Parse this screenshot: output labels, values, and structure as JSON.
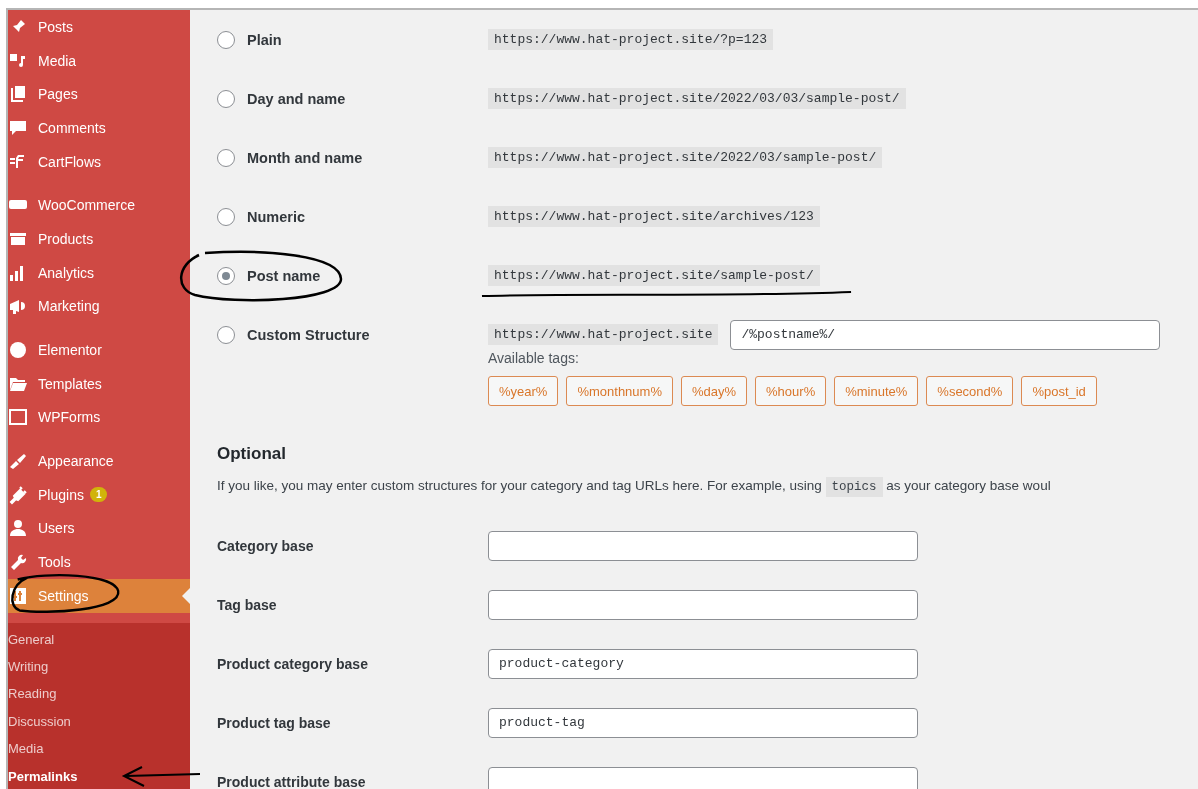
{
  "sidebar": {
    "groups": [
      {
        "items": [
          {
            "label": "Posts"
          },
          {
            "label": "Media"
          },
          {
            "label": "Pages"
          },
          {
            "label": "Comments"
          },
          {
            "label": "CartFlows"
          }
        ]
      },
      {
        "items": [
          {
            "label": "WooCommerce"
          },
          {
            "label": "Products"
          },
          {
            "label": "Analytics"
          },
          {
            "label": "Marketing"
          }
        ]
      },
      {
        "items": [
          {
            "label": "Elementor"
          },
          {
            "label": "Templates"
          },
          {
            "label": "WPForms"
          }
        ]
      },
      {
        "items": [
          {
            "label": "Appearance"
          },
          {
            "label": "Plugins",
            "badge": "1"
          },
          {
            "label": "Users"
          },
          {
            "label": "Tools"
          },
          {
            "label": "Settings",
            "selected": true,
            "circled": true
          }
        ]
      }
    ],
    "submenu": [
      {
        "label": "General",
        "selected": false,
        "arrow": false
      },
      {
        "label": "Writing",
        "selected": false,
        "arrow": false
      },
      {
        "label": "Reading",
        "selected": false,
        "arrow": false
      },
      {
        "label": "Discussion",
        "selected": false,
        "arrow": false
      },
      {
        "label": "Media",
        "selected": false,
        "arrow": false
      },
      {
        "label": "Permalinks",
        "selected": true,
        "arrow": true
      }
    ]
  },
  "permalink_options": [
    {
      "label": "Plain",
      "example": "https://www.hat-project.site/?p=123",
      "selected": false,
      "circled": false,
      "underlined": false
    },
    {
      "label": "Day and name",
      "example": "https://www.hat-project.site/2022/03/03/sample-post/",
      "selected": false,
      "circled": false,
      "underlined": false
    },
    {
      "label": "Month and name",
      "example": "https://www.hat-project.site/2022/03/sample-post/",
      "selected": false,
      "circled": false,
      "underlined": false
    },
    {
      "label": "Numeric",
      "example": "https://www.hat-project.site/archives/123",
      "selected": false,
      "circled": false,
      "underlined": false
    },
    {
      "label": "Post name",
      "example": "https://www.hat-project.site/sample-post/",
      "selected": true,
      "circled": true,
      "underlined": true
    }
  ],
  "custom_structure": {
    "label": "Custom Structure",
    "selected": false,
    "prefix": "https://www.hat-project.site",
    "value": "/%postname%/",
    "tags_label": "Available tags:",
    "tags": [
      "%year%",
      "%monthnum%",
      "%day%",
      "%hour%",
      "%minute%",
      "%second%",
      "%post_id"
    ]
  },
  "optional": {
    "heading": "Optional",
    "description_before": "If you like, you may enter custom structures for your category and tag URLs here. For example, using",
    "description_code": "topics",
    "description_after": "as your category base woul",
    "fields": [
      {
        "label": "Category base"
      },
      {
        "label": "Tag base"
      },
      {
        "label": "Product category base",
        "value": "product-category"
      },
      {
        "label": "Product tag base",
        "value": "product-tag"
      },
      {
        "label": "Product attribute base"
      }
    ]
  }
}
